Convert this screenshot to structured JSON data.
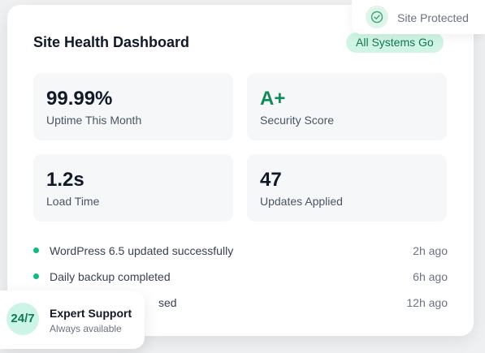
{
  "dashboard": {
    "title": "Site Health Dashboard",
    "status_pill": "All Systems Go"
  },
  "stats": [
    {
      "value": "99.99%",
      "label": "Uptime This Month"
    },
    {
      "value": "A+",
      "label": "Security Score",
      "accent": "#0f8a5a"
    },
    {
      "value": "1.2s",
      "label": "Load Time"
    },
    {
      "value": "47",
      "label": "Updates Applied"
    }
  ],
  "activity": [
    {
      "text": "WordPress 6.5 updated successfully",
      "time": "2h ago"
    },
    {
      "text": "Daily backup completed",
      "time": "6h ago"
    },
    {
      "text": "sed",
      "time": "12h ago"
    }
  ],
  "protected_badge": {
    "text": "Site Protected",
    "icon": "check-circle-icon"
  },
  "support_badge": {
    "badge": "24/7",
    "title": "Expert Support",
    "subtitle": "Always available"
  },
  "colors": {
    "accent_green": "#10b981",
    "pill_bg": "#d1f5e4"
  }
}
